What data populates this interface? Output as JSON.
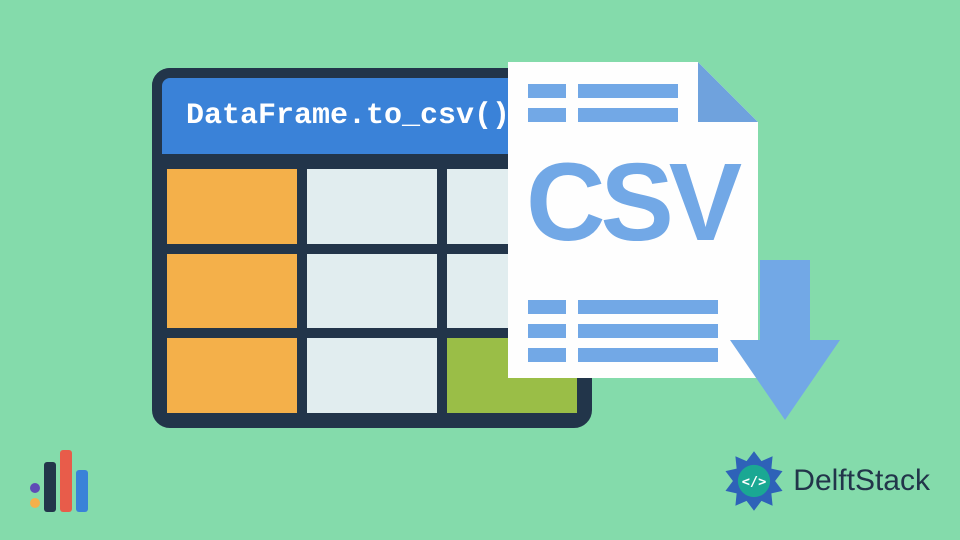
{
  "header": {
    "code": "DataFrame.to_csv()"
  },
  "file": {
    "label": "CSV"
  },
  "brand": {
    "name": "DelftStack"
  },
  "colors": {
    "bg": "#84dbab",
    "dark": "#22354a",
    "blue": "#3a82d8",
    "lightblue": "#72a8e6",
    "orange": "#f4b04a",
    "green": "#9abe47",
    "pale": "#e1edef"
  }
}
